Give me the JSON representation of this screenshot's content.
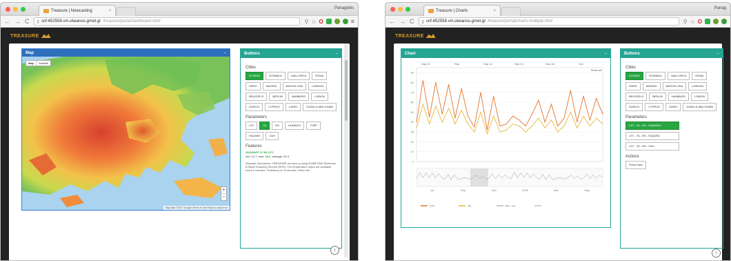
{
  "left": {
    "tab_title": "Treasure | Nowcasting",
    "profile": "Panagiotis",
    "url_host": "snf-652558.vm.okeanos.grnet.gr",
    "url_path": "/treasure/portal/dashboard.html",
    "brand": "TREASURE",
    "map_panel_title": "Map",
    "map_type_map": "Map",
    "map_type_satellite": "Satellite",
    "map_attrib": "Map data ©2017 Google   Terms of Use   Report a map error",
    "buttons_panel_title": "Buttons",
    "cities_label": "Cities",
    "cities": [
      "ATHENS",
      "ISTANBUL",
      "MALLORCA",
      "ROMA",
      "PARIS",
      "MADRID",
      "BARCELONA",
      "LONDON",
      "BRUSSELS",
      "BERLIN",
      "HAMBURG",
      "LISBON",
      "ZURICH",
      "CYPRUS",
      "CAIRO",
      "DUBAI & ABU DHABI"
    ],
    "parameters_label": "Parameters",
    "parameters": [
      "LST",
      "TA",
      "RH",
      "HUMIDEX",
      "THPP",
      "HAZARD",
      "CDH"
    ],
    "features_label": "Features",
    "feature_time": "2016/08/07 07:00 UTC",
    "feature_line": "min: 14.7, max: 38.2, average: 32.4",
    "feature_max": "38.2",
    "feature_text": "Nowcast Operations: TREASURE services is using EUMETSAT Meteosat-8 Rapid Scanning Service (RSS). The temperature maps are available every 5 minutes. Timeliness is 20 minutes. When the"
  },
  "right": {
    "tab_title": "Treasure | Charts",
    "profile": "Panag",
    "url_host": "snf-652558.vm.okeanos.grnet.gr",
    "url_path": "/treasure/portal/charts-multiple.html",
    "brand": "TREASURE",
    "chart_panel_title": "Chart",
    "show_all": "Show all",
    "buttons_panel_title": "Buttons",
    "cities_label": "Cities",
    "cities": [
      "ATHENS",
      "ISTANBUL",
      "MALLORCA",
      "ROMA",
      "PARIS",
      "MADRID",
      "BARCELONA",
      "LONDON",
      "BRUSSELS",
      "BERLIN",
      "HAMBURG",
      "LISBON",
      "ZURICH",
      "CYPRUS",
      "CAIRO",
      "DUBAI & ABU DHABI"
    ],
    "parameters_label": "Parameters",
    "parameter_groups": [
      "LST - TA - RH - HUMIDEX",
      "LST - TA - RH - HAZARD",
      "LST - TA - RH - CDH"
    ],
    "actions_label": "Actions",
    "actions": [
      "Fetch Data"
    ]
  },
  "chart_data": {
    "type": "line",
    "xlabel": "",
    "ylabel": "",
    "x_top_ticks": [
      "Aug 21",
      "Sep",
      "Sep 14",
      "Sep 21",
      "Sep 28",
      "Oct"
    ],
    "x_nav_ticks": [
      "Jul",
      "Sep",
      "Nov",
      "2016",
      "Mar",
      "May"
    ],
    "y_ticks": [
      90,
      80,
      70,
      60,
      50,
      40,
      30,
      20,
      10,
      0
    ],
    "ylim": [
      0,
      95
    ],
    "series": [
      {
        "name": "LST",
        "color": "#e4732a",
        "values": [
          40,
          82,
          45,
          80,
          48,
          78,
          44,
          74,
          46,
          35,
          70,
          32,
          66,
          36,
          38,
          46,
          42,
          36,
          48,
          62,
          40,
          58,
          36,
          44,
          72,
          40,
          66,
          42,
          64,
          48
        ]
      },
      {
        "name": "TA",
        "color": "#e9b83c",
        "values": [
          34,
          58,
          38,
          56,
          40,
          54,
          38,
          52,
          38,
          30,
          50,
          28,
          46,
          30,
          32,
          38,
          36,
          30,
          36,
          44,
          34,
          42,
          30,
          36,
          50,
          34,
          46,
          36,
          44,
          38
        ]
      },
      {
        "name": "RH - Hu",
        "color": "#bbbbbb",
        "values": []
      },
      {
        "name": "",
        "color": "#bdbdbd",
        "values": []
      }
    ],
    "legend": "bottom"
  }
}
